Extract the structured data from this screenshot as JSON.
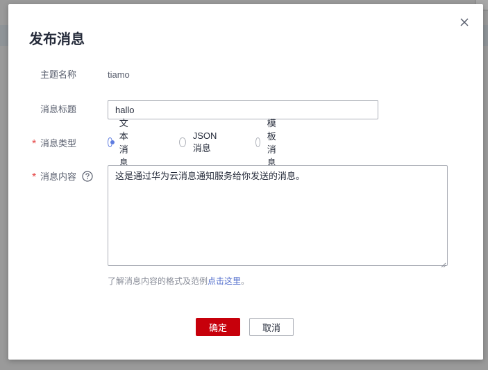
{
  "dialog": {
    "title": "发布消息",
    "close_icon": "close-icon"
  },
  "form": {
    "topic_name": {
      "label": "主题名称",
      "value": "tiamo"
    },
    "message_title": {
      "label": "消息标题",
      "value": "hallo"
    },
    "message_type": {
      "label": "消息类型",
      "required": "*",
      "options": [
        {
          "label": "文本消息",
          "checked": true
        },
        {
          "label": "JSON消息",
          "checked": false
        },
        {
          "label": "模板消息",
          "checked": false
        }
      ]
    },
    "message_content": {
      "label": "消息内容",
      "required": "*",
      "help_icon": "question-circle-icon",
      "value": "这是通过华为云消息通知服务给你发送的消息。"
    },
    "hint": {
      "prefix": "了解消息内容的格式及范例",
      "link": "点击这里",
      "suffix": "。"
    }
  },
  "footer": {
    "confirm_label": "确定",
    "cancel_label": "取消"
  },
  "colors": {
    "primary": "#c7000b",
    "accent": "#5e7ce0",
    "link": "#526ecc",
    "required": "#e54545"
  }
}
